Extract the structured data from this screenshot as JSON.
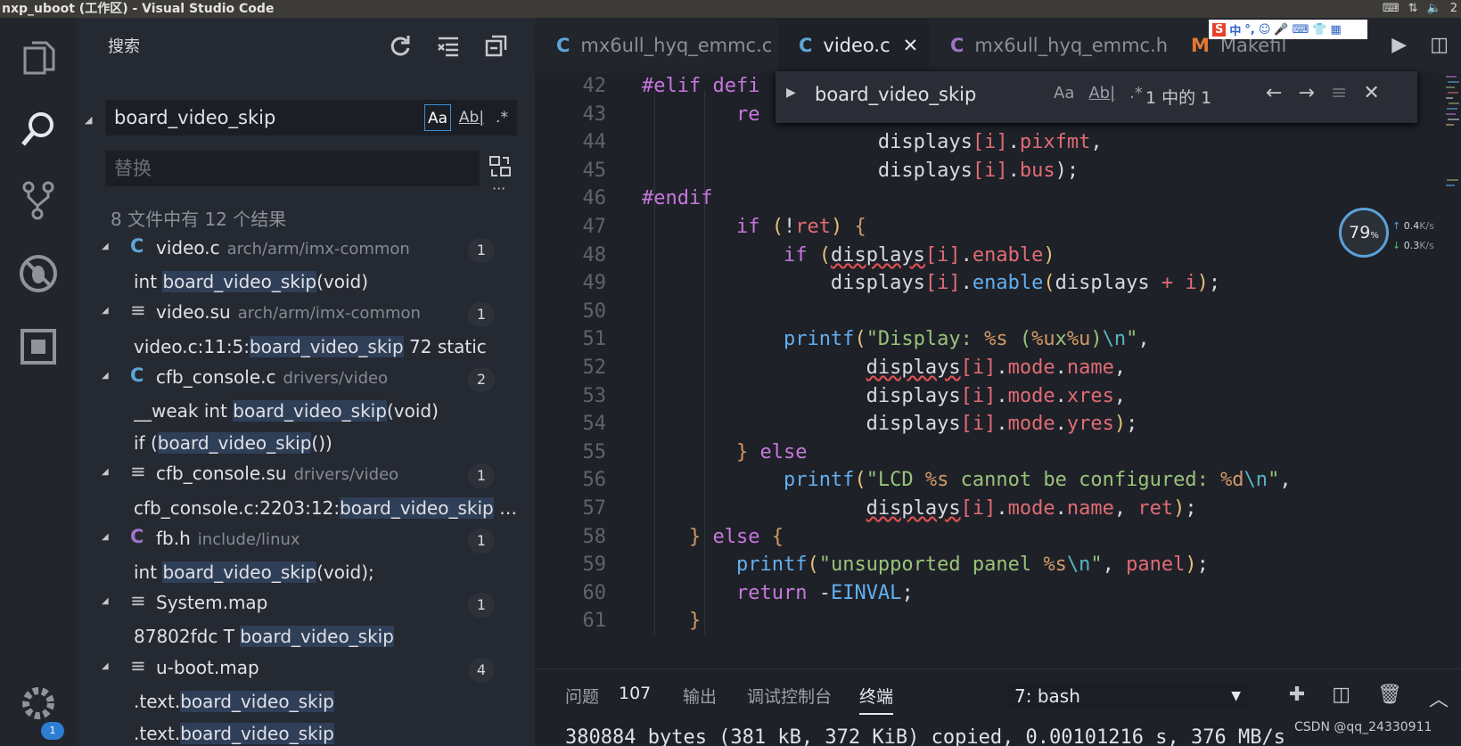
{
  "window": {
    "title": "nxp_uboot (工作区) - Visual Studio Code",
    "clock": "2"
  },
  "ime": {
    "label": "中"
  },
  "sidebar": {
    "title": "搜索",
    "search_value": "board_video_skip",
    "opt_case": "Aa",
    "opt_word": "Ab|",
    "opt_regex": ".*",
    "replace_placeholder": "替换",
    "summary": "8 文件中有 12 个结果",
    "more": "···",
    "files": [
      {
        "name": "video.c",
        "path": "arch/arm/imx-common",
        "count": "1",
        "icon": "C"
      },
      {
        "name": "video.su",
        "path": "arch/arm/imx-common",
        "count": "1",
        "icon": "≡"
      },
      {
        "name": "cfb_console.c",
        "path": "drivers/video",
        "count": "2",
        "icon": "C"
      },
      {
        "name": "cfb_console.su",
        "path": "drivers/video",
        "count": "1",
        "icon": "≡"
      },
      {
        "name": "fb.h",
        "path": "include/linux",
        "count": "1",
        "icon": "C"
      },
      {
        "name": "System.map",
        "path": "",
        "count": "1",
        "icon": "≡"
      },
      {
        "name": "u-boot.map",
        "path": "",
        "count": "4",
        "icon": "≡"
      }
    ],
    "matches": [
      {
        "pre": "int ",
        "hit": "board_video_skip",
        "post": "(void)"
      },
      {
        "pre": "video.c:11:5:",
        "hit": "board_video_skip",
        "post": "    72   static"
      },
      {
        "pre": "__weak int ",
        "hit": "board_video_skip",
        "post": "(void)"
      },
      {
        "pre": "if (",
        "hit": "board_video_skip",
        "post": "())"
      },
      {
        "pre": "cfb_console.c:2203:12:",
        "hit": "board_video_skip",
        "post": " …"
      },
      {
        "pre": "int ",
        "hit": "board_video_skip",
        "post": "(void);"
      },
      {
        "pre": "87802fdc T ",
        "hit": "board_video_skip",
        "post": ""
      },
      {
        "pre": ".text.",
        "hit": "board_video_skip",
        "post": ""
      },
      {
        "pre": ".text.",
        "hit": "board_video_skip",
        "post": ""
      }
    ]
  },
  "tabs": [
    {
      "icon": "C",
      "label": "mx6ull_hyq_emmc.c",
      "active": false
    },
    {
      "icon": "C",
      "label": "video.c",
      "active": true,
      "close": "✕"
    },
    {
      "icon": "C",
      "label": "mx6ull_hyq_emmc.h",
      "active": false
    },
    {
      "icon": "M",
      "label": "Makefil",
      "active": false
    }
  ],
  "find": {
    "value": "board_video_skip",
    "case": "Aa",
    "word": "Ab|",
    "regex": ".*",
    "result": "1 中的 1"
  },
  "net": {
    "percent": "79",
    "unit": "%",
    "up": "0.4",
    "down": "0.3",
    "rate_unit": "K/s"
  },
  "code": {
    "line_numbers": [
      "42",
      "43",
      "44",
      "45",
      "46",
      "47",
      "48",
      "49",
      "50",
      "51",
      "52",
      "53",
      "54",
      "55",
      "56",
      "57",
      "58",
      "59",
      "60",
      "61"
    ]
  },
  "panel": {
    "tabs": [
      "问题",
      "输出",
      "调试控制台",
      "终端"
    ],
    "problems_count": "107",
    "terminal_select": "7: bash",
    "terminal_line": "380884 bytes (381 kB, 372 KiB) copied, 0.00101216 s, 376 MB/s",
    "watermark": "CSDN @qq_24330911"
  },
  "activity": {
    "badge": "1"
  }
}
